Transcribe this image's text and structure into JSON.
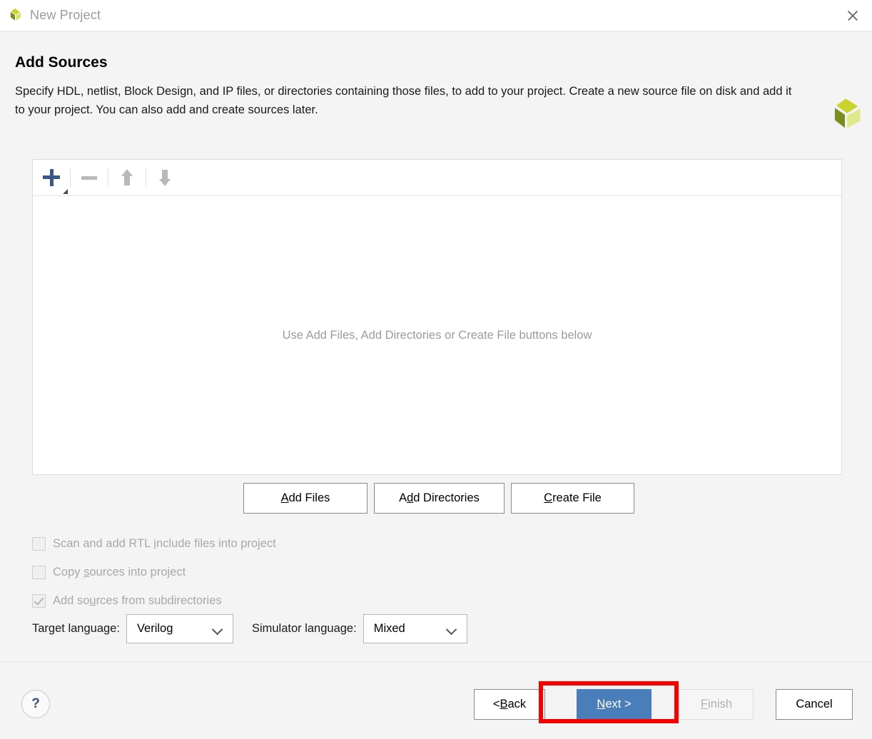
{
  "window": {
    "title": "New Project",
    "logo_icon": "xilinx-logo-icon",
    "close_icon": "close-icon"
  },
  "header": {
    "title": "Add Sources",
    "description": "Specify HDL, netlist, Block Design, and IP files, or directories containing those files, to add to your project. Create a new source file on disk and add it to your project. You can also add and create sources later.",
    "brand_logo_icon": "xilinx-logo-icon"
  },
  "sources_panel": {
    "toolbar": [
      {
        "name": "add-button",
        "icon": "plus-icon",
        "enabled": true
      },
      {
        "name": "remove-button",
        "icon": "minus-icon",
        "enabled": false
      },
      {
        "name": "move-up-button",
        "icon": "arrow-up-icon",
        "enabled": false
      },
      {
        "name": "move-down-button",
        "icon": "arrow-down-icon",
        "enabled": false
      }
    ],
    "empty_hint": "Use Add Files, Add Directories or Create File buttons below"
  },
  "source_buttons": {
    "add_files": {
      "pre": "A",
      "mnemonic": "",
      "post": "dd Files",
      "label": "Add Files"
    },
    "add_directories": {
      "pre": "A",
      "mnemonic": "d",
      "post": "d Directories",
      "label": "Add Directories"
    },
    "create_file": {
      "pre": "",
      "mnemonic": "C",
      "post": "reate File",
      "label": "Create File"
    }
  },
  "options": [
    {
      "name": "scan-rtl-include-files",
      "pre": "Scan and add RTL ",
      "mnemonic": "i",
      "post": "nclude files into project",
      "label": "Scan and add RTL include files into project",
      "checked": false,
      "enabled": false
    },
    {
      "name": "copy-sources-into-project",
      "pre": "Copy ",
      "mnemonic": "s",
      "post": "ources into project",
      "label": "Copy sources into project",
      "checked": false,
      "enabled": false
    },
    {
      "name": "add-sources-from-subdirectories",
      "pre": "Add so",
      "mnemonic": "u",
      "post": "rces from subdirectories",
      "label": "Add sources from subdirectories",
      "checked": true,
      "enabled": false
    }
  ],
  "languages": {
    "target_label": "Target language:",
    "target_value": "Verilog",
    "simulator_label": "Simulator language:",
    "simulator_value": "Mixed"
  },
  "footer": {
    "help_label": "?",
    "back": {
      "pre": "< ",
      "mnemonic": "B",
      "post": "ack",
      "label": "< Back"
    },
    "next": {
      "pre": "",
      "mnemonic": "N",
      "post": "ext >",
      "label": "Next >"
    },
    "finish": {
      "pre": "",
      "mnemonic": "F",
      "post": "inish",
      "label": "Finish"
    },
    "cancel": {
      "label": "Cancel"
    }
  },
  "annotation": {
    "highlight_color": "#f60000",
    "target": "next-button"
  },
  "colors": {
    "accent_blue": "#4a7ebb",
    "plus_blue": "#3a5588",
    "body_bg": "#f4f4f4",
    "panel_bg": "#ffffff",
    "disabled_text": "#a8a8a8"
  }
}
